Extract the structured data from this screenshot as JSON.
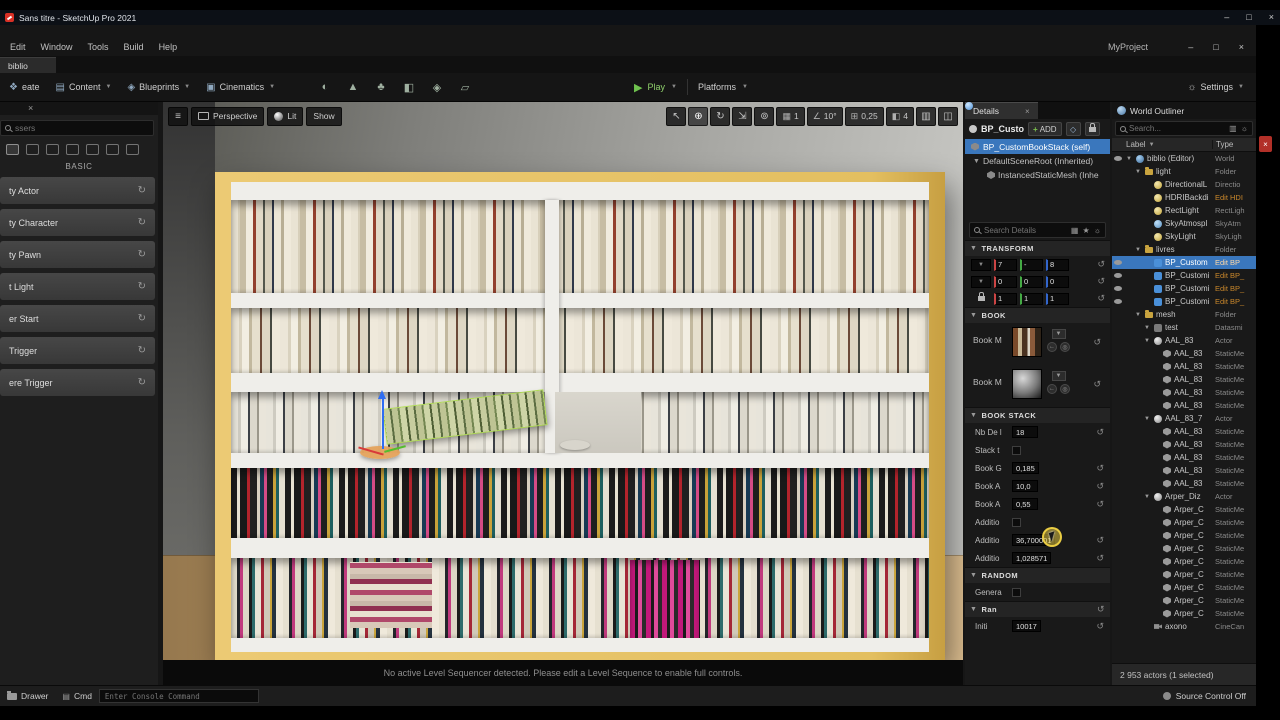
{
  "titlebar": {
    "title": "Sans titre - SketchUp Pro 2021"
  },
  "menubar": {
    "items": [
      "Edit",
      "Window",
      "Tools",
      "Build",
      "Help"
    ],
    "project": "MyProject"
  },
  "tabs": {
    "level_tab": "biblio"
  },
  "toolbar": {
    "create": "eate",
    "content": "Content",
    "blueprints": "Blueprints",
    "cinematics": "Cinematics",
    "play": "Play",
    "platforms": "Platforms",
    "settings": "Settings"
  },
  "place_actors": {
    "search_placeholder": "ssers",
    "section_label": "BASIC",
    "items": [
      "ty Actor",
      "ty Character",
      "ty Pawn",
      "t Light",
      "er Start",
      "Trigger",
      "ere Trigger"
    ]
  },
  "viewport": {
    "perspective_label": "Perspective",
    "lit_label": "Lit",
    "show_label": "Show",
    "grid_snap": "1",
    "angle_snap": "10°",
    "scale_snap": "0,25",
    "camera_speed": "4",
    "status_message": "No active Level Sequencer detected. Please edit a Level Sequence to enable full controls."
  },
  "details": {
    "tab_title": "Details",
    "component_name": "BP_Custo",
    "add_label": "ADD",
    "self_row": "BP_CustomBookStack  (self)",
    "tree": [
      "DefaultSceneRoot (Inherited)",
      "InstancedStaticMesh (Inhe"
    ],
    "search_placeholder": "Search Details",
    "transform": {
      "title": "TRANSFORM",
      "location": [
        "7",
        "-",
        "8"
      ],
      "rotation": [
        "0",
        "0",
        "0"
      ],
      "scale": [
        "1",
        "1",
        "1"
      ]
    },
    "book": {
      "title": "BOOK",
      "rows": [
        {
          "label": "Book M",
          "thumb": "book-cover"
        },
        {
          "label": "Book M",
          "thumb": "sphere"
        }
      ]
    },
    "book_stack": {
      "title": "BOOK STACK",
      "rows": [
        {
          "label": "Nb De l",
          "value": "18"
        },
        {
          "label": "Stack t",
          "checkbox": true
        },
        {
          "label": "Book G",
          "value": "0,185"
        },
        {
          "label": "Book A",
          "value": "10,0"
        },
        {
          "label": "Book A",
          "value": "0,55"
        },
        {
          "label": "Additio",
          "checkbox": true
        },
        {
          "label": "Additio",
          "value": "36,700001"
        },
        {
          "label": "Additio",
          "value": "1,028571"
        }
      ]
    },
    "random": {
      "title": "RANDOM",
      "rows": [
        {
          "label": "Genera",
          "checkbox": true
        }
      ]
    },
    "ran": {
      "title": "Ran",
      "rows": [
        {
          "label": "Initi",
          "value": "10017"
        }
      ]
    }
  },
  "outliner": {
    "title": "World Outliner",
    "search_placeholder": "Search...",
    "label_col": "Label",
    "type_col": "Type",
    "footer": "2 953 actors (1 selected)",
    "rows": [
      {
        "label": "biblio (Editor)",
        "type": "World",
        "indent": 0,
        "kind": "world",
        "expand": true,
        "eye": true
      },
      {
        "label": "light",
        "type": "Folder",
        "indent": 1,
        "kind": "folder",
        "expand": true
      },
      {
        "label": "DirectionalL",
        "type": "Directio",
        "indent": 2,
        "kind": "light"
      },
      {
        "label": "HDRIBackdi",
        "type": "Edit HDI",
        "indent": 2,
        "kind": "light",
        "tcls": "link"
      },
      {
        "label": "RectLight",
        "type": "RectLigh",
        "indent": 2,
        "kind": "light"
      },
      {
        "label": "SkyAtmospl",
        "type": "SkyAtm",
        "indent": 2,
        "kind": "sky"
      },
      {
        "label": "SkyLight",
        "type": "SkyLigh",
        "indent": 2,
        "kind": "light"
      },
      {
        "label": "livres",
        "type": "Folder",
        "indent": 1,
        "kind": "folder",
        "expand": true
      },
      {
        "label": "BP_Custom",
        "type": "Edit BP",
        "indent": 2,
        "kind": "bp",
        "eye": true,
        "tcls": "link",
        "state": "selected"
      },
      {
        "label": "BP_Customi",
        "type": "Edit BP_",
        "indent": 2,
        "kind": "bp",
        "eye": true,
        "tcls": "link"
      },
      {
        "label": "BP_Customi",
        "type": "Edit BP_",
        "indent": 2,
        "kind": "bp",
        "eye": true,
        "tcls": "link"
      },
      {
        "label": "BP_Customi",
        "type": "Edit BP_",
        "indent": 2,
        "kind": "bp",
        "eye": true,
        "tcls": "link"
      },
      {
        "label": "mesh",
        "type": "Folder",
        "indent": 1,
        "kind": "folder",
        "expand": true
      },
      {
        "label": "test",
        "type": "Datasmi",
        "indent": 2,
        "kind": "datasmith",
        "expand": true
      },
      {
        "label": "AAL_83",
        "type": "Actor",
        "indent": 2,
        "kind": "actor",
        "expand": true
      },
      {
        "label": "AAL_83",
        "type": "StaticMe",
        "indent": 3,
        "kind": "mesh"
      },
      {
        "label": "AAL_83",
        "type": "StaticMe",
        "indent": 3,
        "kind": "mesh"
      },
      {
        "label": "AAL_83",
        "type": "StaticMe",
        "indent": 3,
        "kind": "mesh"
      },
      {
        "label": "AAL_83",
        "type": "StaticMe",
        "indent": 3,
        "kind": "mesh"
      },
      {
        "label": "AAL_83",
        "type": "StaticMe",
        "indent": 3,
        "kind": "mesh"
      },
      {
        "label": "AAL_83_7",
        "type": "Actor",
        "indent": 2,
        "kind": "actor",
        "expand": true
      },
      {
        "label": "AAL_83",
        "type": "StaticMe",
        "indent": 3,
        "kind": "mesh"
      },
      {
        "label": "AAL_83",
        "type": "StaticMe",
        "indent": 3,
        "kind": "mesh"
      },
      {
        "label": "AAL_83",
        "type": "StaticMe",
        "indent": 3,
        "kind": "mesh"
      },
      {
        "label": "AAL_83",
        "type": "StaticMe",
        "indent": 3,
        "kind": "mesh"
      },
      {
        "label": "AAL_83",
        "type": "StaticMe",
        "indent": 3,
        "kind": "mesh"
      },
      {
        "label": "Arper_Diz",
        "type": "Actor",
        "indent": 2,
        "kind": "actor",
        "expand": true
      },
      {
        "label": "Arper_C",
        "type": "StaticMe",
        "indent": 3,
        "kind": "mesh"
      },
      {
        "label": "Arper_C",
        "type": "StaticMe",
        "indent": 3,
        "kind": "mesh"
      },
      {
        "label": "Arper_C",
        "type": "StaticMe",
        "indent": 3,
        "kind": "mesh"
      },
      {
        "label": "Arper_C",
        "type": "StaticMe",
        "indent": 3,
        "kind": "mesh"
      },
      {
        "label": "Arper_C",
        "type": "StaticMe",
        "indent": 3,
        "kind": "mesh"
      },
      {
        "label": "Arper_C",
        "type": "StaticMe",
        "indent": 3,
        "kind": "mesh"
      },
      {
        "label": "Arper_C",
        "type": "StaticMe",
        "indent": 3,
        "kind": "mesh"
      },
      {
        "label": "Arper_C",
        "type": "StaticMe",
        "indent": 3,
        "kind": "mesh"
      },
      {
        "label": "Arper_C",
        "type": "StaticMe",
        "indent": 3,
        "kind": "mesh"
      },
      {
        "label": "axono",
        "type": "CineCan",
        "indent": 2,
        "kind": "camera"
      }
    ]
  },
  "bottombar": {
    "drawer": "Drawer",
    "cmd": "Cmd",
    "console_placeholder": "Enter Console Command",
    "source_control": "Source Control Off"
  },
  "colors": {
    "selection_blue": "#3a77bd",
    "link_orange": "#c8872b",
    "play_green": "#6fc24e",
    "shelf_yellow": "#e3bf60",
    "folder_yellow": "#c9a43f"
  }
}
